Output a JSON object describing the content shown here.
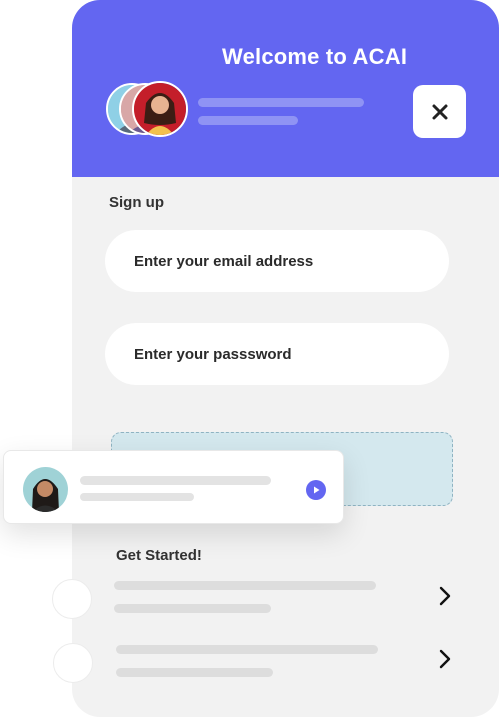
{
  "header": {
    "title": "Welcome to ACAI"
  },
  "signup": {
    "heading": "Sign up",
    "email_field": "Enter your email address",
    "password_field": "Enter your passsword"
  },
  "getting_started": {
    "heading": "Get Started!"
  },
  "icons": {
    "close": "close-icon",
    "play": "play-icon",
    "chevron": "chevron-right-icon"
  },
  "colors": {
    "accent": "#6366f1",
    "card_background": "#f2f2f2",
    "dashed_box": "#d4e8ee"
  }
}
